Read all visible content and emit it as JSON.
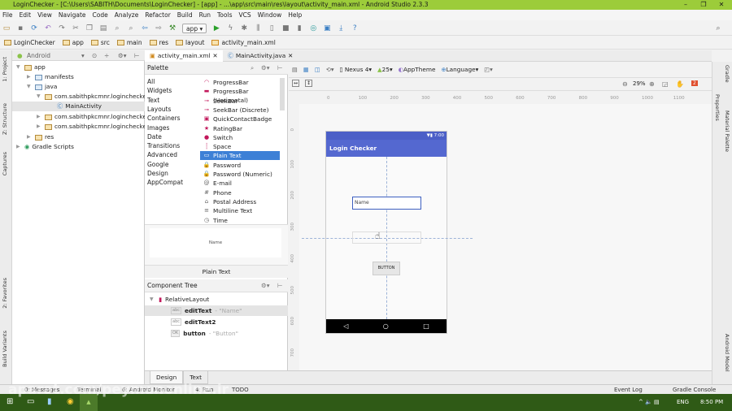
{
  "window": {
    "title": "LoginChecker - [C:\\Users\\SABITH\\Documents\\LoginChecker] - [app] - ...\\app\\src\\main\\res\\layout\\activity_main.xml - Android Studio 2.3.3"
  },
  "menu": [
    "File",
    "Edit",
    "View",
    "Navigate",
    "Code",
    "Analyze",
    "Refactor",
    "Build",
    "Run",
    "Tools",
    "VCS",
    "Window",
    "Help"
  ],
  "toolbar": {
    "run_config": "app"
  },
  "breadcrumbs": [
    "LoginChecker",
    "app",
    "src",
    "main",
    "res",
    "layout",
    "activity_main.xml"
  ],
  "project": {
    "view": "Android",
    "tree": [
      {
        "label": "app",
        "depth": 0
      },
      {
        "label": "manifests",
        "depth": 1
      },
      {
        "label": "java",
        "depth": 1
      },
      {
        "label": "com.sabithpkcmnr.loginchecker",
        "depth": 2
      },
      {
        "label": "MainActivity",
        "depth": 3
      },
      {
        "label": "com.sabithpkcmnr.loginchecker",
        "depth": 2
      },
      {
        "label": "com.sabithpkcmnr.loginchecker",
        "depth": 2
      },
      {
        "label": "res",
        "depth": 1
      },
      {
        "label": "Gradle Scripts",
        "depth": 0
      }
    ]
  },
  "left_tool_tabs": [
    "1: Project",
    "Z: Structure",
    "Captures",
    "2: Favorites",
    "Build Variants"
  ],
  "right_tool_tabs": [
    "Gradle",
    "Properties",
    "Material Palette",
    "Android Model"
  ],
  "editor_tabs": [
    {
      "label": "activity_main.xml",
      "active": true
    },
    {
      "label": "MainActivity.java",
      "active": false
    }
  ],
  "palette": {
    "title": "Palette",
    "categories": [
      "All",
      "Widgets",
      "Text",
      "Layouts",
      "Containers",
      "Images",
      "Date",
      "Transitions",
      "Advanced",
      "Google",
      "Design",
      "AppCompat"
    ],
    "items": [
      "ProgressBar",
      "ProgressBar (Horizontal)",
      "SeekBar",
      "SeekBar (Discrete)",
      "QuickContactBadge",
      "RatingBar",
      "Switch",
      "Space",
      "Plain Text",
      "Password",
      "Password (Numeric)",
      "E-mail",
      "Phone",
      "Postal Address",
      "Multiline Text",
      "Time"
    ],
    "selected": "Plain Text",
    "preview_text": "Name",
    "preview_label": "Plain Text"
  },
  "component_tree": {
    "title": "Component Tree",
    "items": [
      {
        "label": "RelativeLayout",
        "hint": ""
      },
      {
        "label": "editText",
        "hint": "- \"Name\""
      },
      {
        "label": "editText2",
        "hint": ""
      },
      {
        "label": "button",
        "hint": "- \"Button\""
      }
    ]
  },
  "design_toolbar": {
    "device": "Nexus 4",
    "api": "25",
    "theme": "AppTheme",
    "language": "Language",
    "zoom": "29%",
    "warnings": "2"
  },
  "ruler": {
    "x": [
      "0",
      "100",
      "200",
      "300",
      "400",
      "500",
      "600",
      "700",
      "800",
      "900",
      "1000",
      "1100"
    ],
    "y": [
      "0",
      "100",
      "200",
      "300",
      "400",
      "500",
      "600",
      "700"
    ]
  },
  "phone": {
    "time": "7:00",
    "app_title": "Login Checker",
    "edit_hint": "Name",
    "button": "BUTTON"
  },
  "bottom_tabs": {
    "design": "Design",
    "text": "Text"
  },
  "status_bar": {
    "left": [
      "0: Messages",
      "Terminal",
      "6: Android Monitor",
      "4: Run",
      "TODO"
    ],
    "right": [
      "Event Log",
      "Gradle Console"
    ]
  },
  "taskbar": {
    "lang": "ENG",
    "time": "8:50 PM"
  },
  "watermark": "aparat.com/peymanonline.ir"
}
